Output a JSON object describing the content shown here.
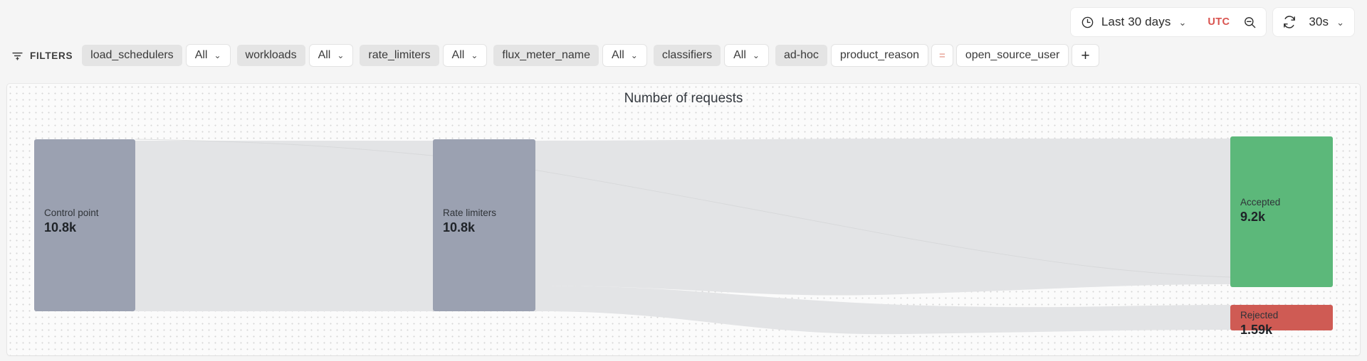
{
  "topbar": {
    "time_range": {
      "icon": "clock-icon",
      "label": "Last 30 days",
      "caret": "⌄"
    },
    "timezone": "UTC",
    "zoom_out": {
      "icon": "zoom-out-icon"
    },
    "refresh": {
      "icon": "refresh-icon"
    },
    "refresh_interval": {
      "label": "30s",
      "caret": "⌄"
    }
  },
  "filters": {
    "icon": "filter-icon",
    "label": "FILTERS",
    "groups": [
      {
        "key": "load_schedulers",
        "value": "All",
        "caret": "⌄"
      },
      {
        "key": "workloads",
        "value": "All",
        "caret": "⌄"
      },
      {
        "key": "rate_limiters",
        "value": "All",
        "caret": "⌄"
      },
      {
        "key": "flux_meter_name",
        "value": "All",
        "caret": "⌄"
      },
      {
        "key": "classifiers",
        "value": "All",
        "caret": "⌄"
      }
    ],
    "adhoc": {
      "key": "ad-hoc",
      "field": "product_reason",
      "operator": "=",
      "value": "open_source_user",
      "add_label": "+"
    }
  },
  "chart_data": {
    "type": "sankey",
    "title": "Number of requests",
    "unit": "requests",
    "nodes": [
      {
        "id": "control_point",
        "label": "Control point",
        "value_label": "10.8k",
        "value": 10800,
        "column": 0,
        "color": "#9ba1b1"
      },
      {
        "id": "rate_limiters",
        "label": "Rate limiters",
        "value_label": "10.8k",
        "value": 10800,
        "column": 1,
        "color": "#9ba1b1"
      },
      {
        "id": "accepted",
        "label": "Accepted",
        "value_label": "9.2k",
        "value": 9200,
        "column": 2,
        "color": "#5cb87a"
      },
      {
        "id": "rejected",
        "label": "Rejected",
        "value_label": "1.59k",
        "value": 1590,
        "column": 2,
        "color": "#cf5b54"
      }
    ],
    "links": [
      {
        "source": "control_point",
        "target": "rate_limiters",
        "value": 10800,
        "color": "#e3e4e6"
      },
      {
        "source": "rate_limiters",
        "target": "accepted",
        "value": 9200,
        "color": "#e3e4e6"
      },
      {
        "source": "rate_limiters",
        "target": "rejected",
        "value": 1590,
        "color": "#e3e4e6"
      }
    ],
    "legend": "none",
    "grid": false
  },
  "colors": {
    "accent_red": "#d9534f",
    "node_gray": "#9ba1b1",
    "node_green": "#5cb87a",
    "node_red": "#cf5b54",
    "link_gray": "#e3e4e6"
  }
}
